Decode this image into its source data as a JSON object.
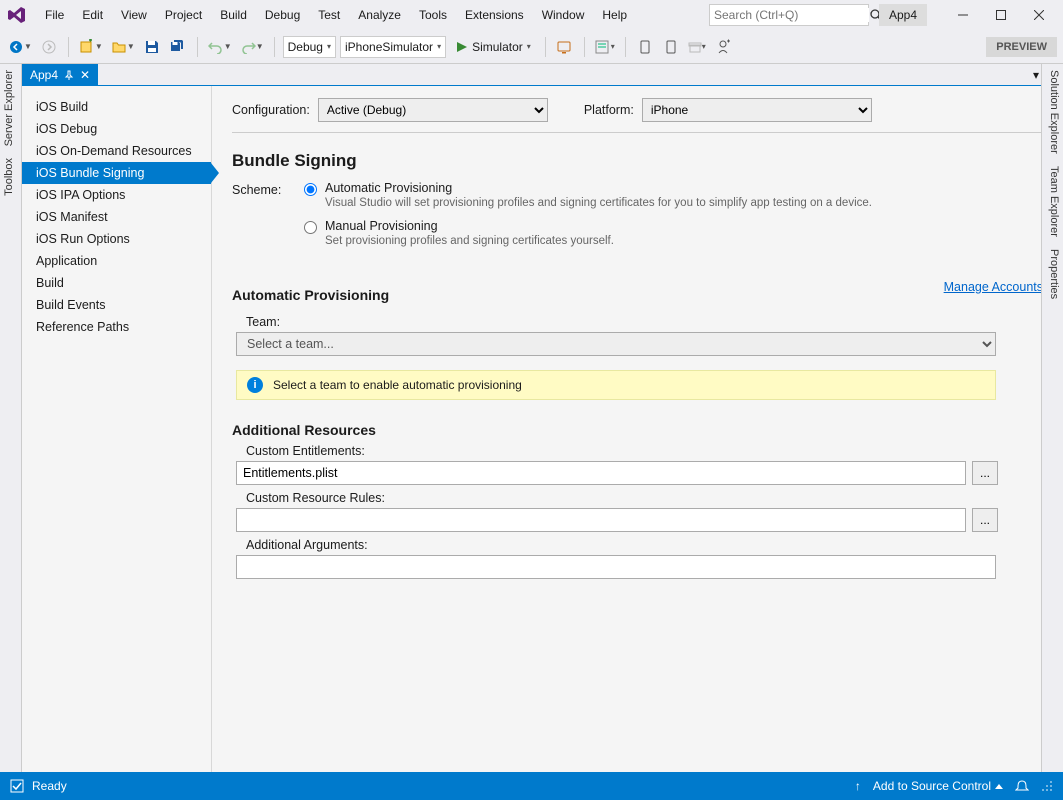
{
  "menu": [
    "File",
    "Edit",
    "View",
    "Project",
    "Build",
    "Debug",
    "Test",
    "Analyze",
    "Tools",
    "Extensions",
    "Window",
    "Help"
  ],
  "search_placeholder": "Search (Ctrl+Q)",
  "solution_name": "App4",
  "toolbar": {
    "config": "Debug",
    "platform_target": "iPhoneSimulator",
    "start_label": "Simulator",
    "preview": "PREVIEW"
  },
  "left_tabs": [
    "Server Explorer",
    "Toolbox"
  ],
  "right_tabs": [
    "Solution Explorer",
    "Team Explorer",
    "Properties"
  ],
  "doc_tab": "App4",
  "nav_items": [
    "iOS Build",
    "iOS Debug",
    "iOS On-Demand Resources",
    "iOS Bundle Signing",
    "iOS IPA Options",
    "iOS Manifest",
    "iOS Run Options",
    "Application",
    "Build",
    "Build Events",
    "Reference Paths"
  ],
  "nav_selected": 3,
  "cfg": {
    "configuration_label": "Configuration:",
    "configuration_value": "Active (Debug)",
    "platform_label": "Platform:",
    "platform_value": "iPhone"
  },
  "bundle_signing_heading": "Bundle Signing",
  "scheme_label": "Scheme:",
  "scheme_auto_title": "Automatic Provisioning",
  "scheme_auto_desc": "Visual Studio will set provisioning profiles and signing certificates for you to simplify app testing on a device.",
  "scheme_manual_title": "Manual Provisioning",
  "scheme_manual_desc": "Set provisioning profiles and signing certificates yourself.",
  "auto_heading": "Automatic Provisioning",
  "manage_link": "Manage Accounts",
  "team_label": "Team:",
  "team_placeholder": "Select a team...",
  "info_text": "Select a team to enable automatic provisioning",
  "additional_heading": "Additional Resources",
  "entitlements_label": "Custom Entitlements:",
  "entitlements_value": "Entitlements.plist",
  "resource_rules_label": "Custom Resource Rules:",
  "resource_rules_value": "",
  "additional_args_label": "Additional Arguments:",
  "additional_args_value": "",
  "browse": "...",
  "status": {
    "ready": "Ready",
    "source_control": "Add to Source Control",
    "publish_icon": "↑"
  }
}
